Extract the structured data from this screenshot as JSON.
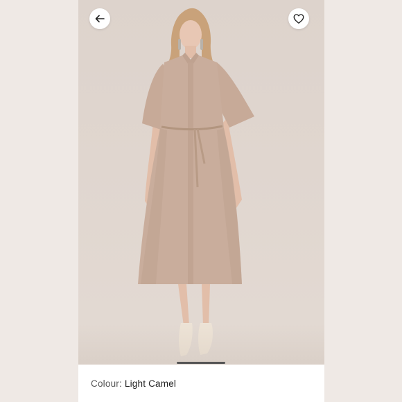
{
  "product": {
    "image_alt": "Model wearing a light camel short-sleeve belted shirt dress",
    "colour_label": "Colour:",
    "colour_value": "Light Camel"
  },
  "navigation": {
    "back_icon": "arrow-left-icon",
    "favourite_icon": "heart-outline-icon"
  },
  "gallery": {
    "active_image_index": 1
  },
  "colors": {
    "dress": "#c9ad9c",
    "background": "#e0d6cf",
    "page": "#efe9e5"
  }
}
